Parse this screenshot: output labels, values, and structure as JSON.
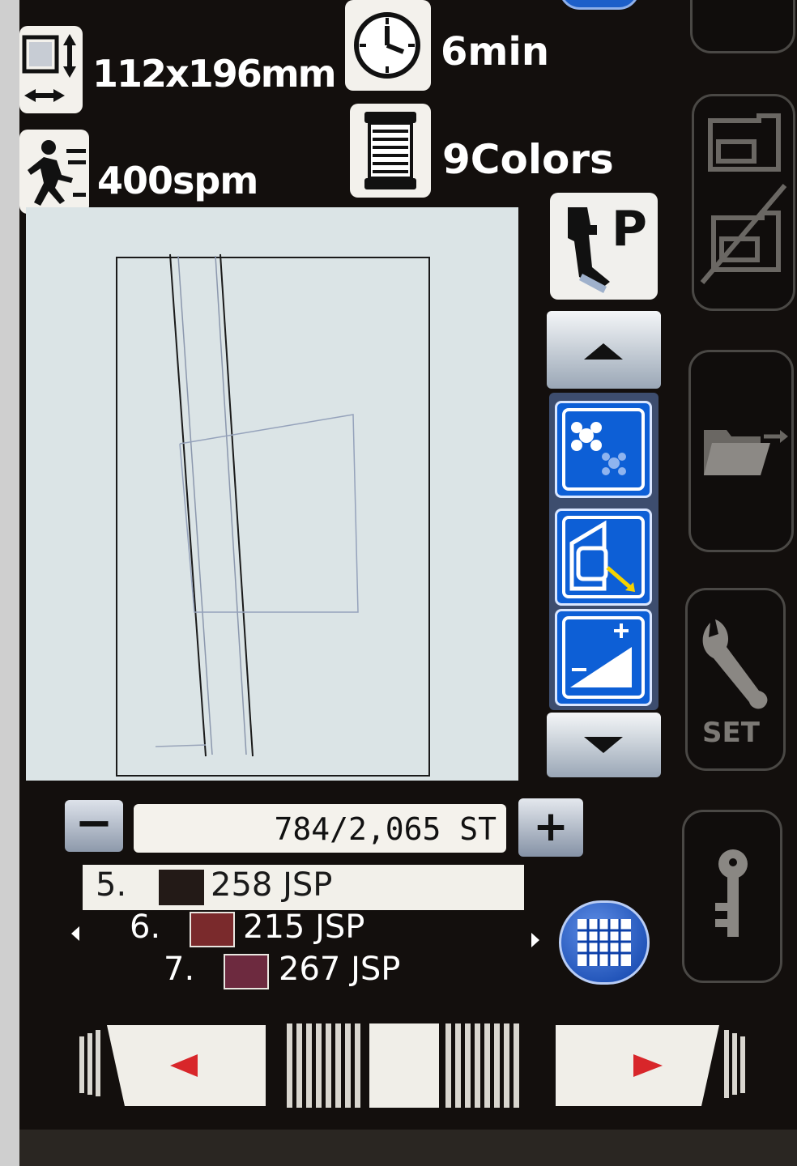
{
  "info": {
    "size": "112x196mm",
    "time": "6min",
    "speed": "400spm",
    "colors": "9Colors"
  },
  "foot_label": "P",
  "stitch_counter": "784/2,065 ST",
  "minus_label": "−",
  "plus_label": "+",
  "color_list": [
    {
      "index": "5.",
      "code": "258 JSP",
      "color": "#231a17"
    },
    {
      "index": "6.",
      "code": "215 JSP",
      "color": "#7a2a2c"
    },
    {
      "index": "7.",
      "code": "267 JSP",
      "color": "#6d2a3f"
    }
  ],
  "side_buttons": [
    "stitch-mode",
    "file-transfer",
    "settings",
    "lock"
  ],
  "set_label": "SET",
  "colors_theme": {
    "screen_bg": "#130f0d",
    "accent_blue": "#0d5fd6",
    "preview_bg": "#dbe4e6"
  }
}
